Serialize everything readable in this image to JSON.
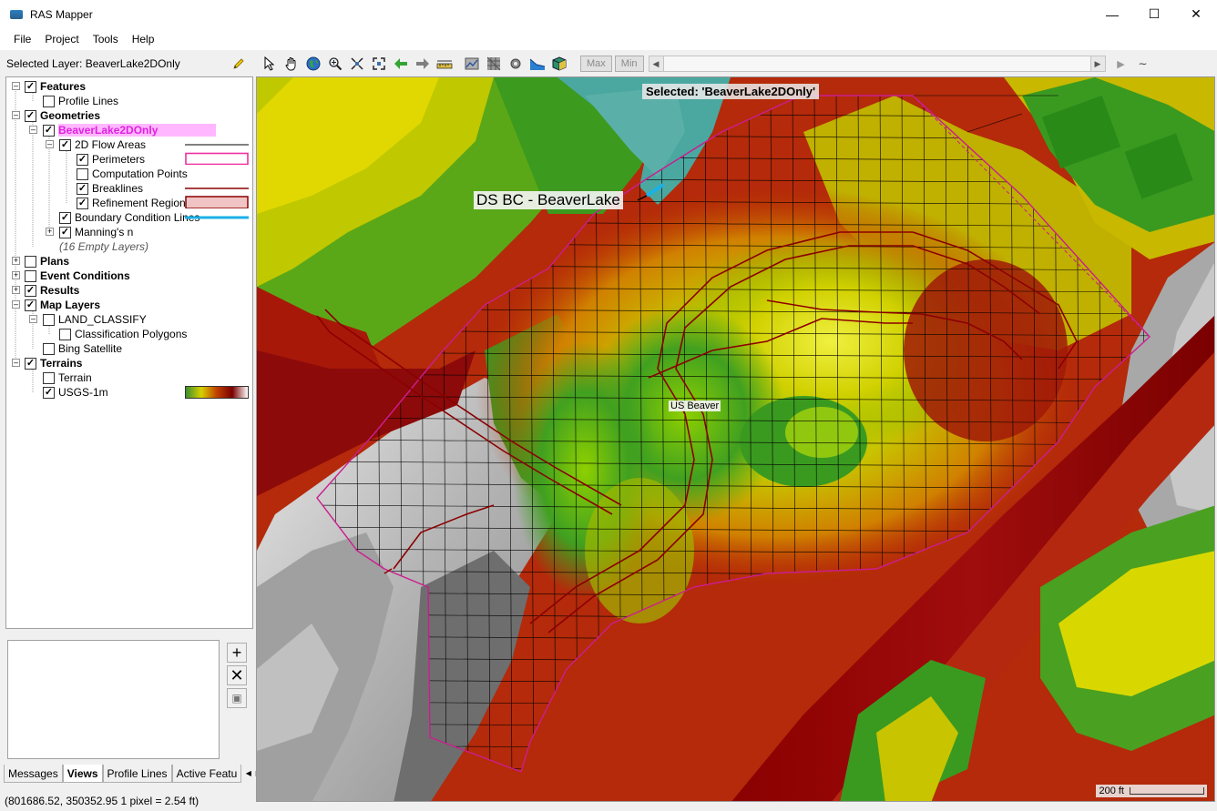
{
  "window": {
    "title": "RAS Mapper"
  },
  "menu": [
    "File",
    "Project",
    "Tools",
    "Help"
  ],
  "selected_layer_text": "Selected Layer: BeaverLake2DOnly",
  "toolbar": {
    "max_label": "Max",
    "min_label": "Min"
  },
  "tree": {
    "features": "Features",
    "profile_lines": "Profile Lines",
    "geometries": "Geometries",
    "beaverlake": "BeaverLake2DOnly",
    "flow_areas": "2D Flow Areas",
    "perimeters": "Perimeters",
    "computation_points": "Computation Points",
    "breaklines": "Breaklines",
    "refinement_regions": "Refinement Regions",
    "boundary_condition_lines": "Boundary Condition Lines",
    "mannings_n": "Manning's n",
    "empty_layers": "(16 Empty Layers)",
    "plans": "Plans",
    "event_conditions": "Event Conditions",
    "results": "Results",
    "map_layers": "Map Layers",
    "land_classify": "LAND_CLASSIFY",
    "classification_polygons": "Classification Polygons",
    "bing_satellite": "Bing Satellite",
    "terrains": "Terrains",
    "terrain": "Terrain",
    "usgs": "USGS-1m"
  },
  "tabs": [
    "Messages",
    "Views",
    "Profile Lines",
    "Active Featu"
  ],
  "status": "(801686.52, 350352.95  1 pixel = 2.54 ft)",
  "map": {
    "selected_label": "Selected: 'BeaverLake2DOnly'",
    "ds_label": "DS BC - BeaverLake",
    "us_label": "US Beaver",
    "scale_label": "200 ft"
  },
  "colors": {
    "perimeter": "#cc1d8f",
    "breakline": "#8b0000",
    "bc_line": "#1ab0e8",
    "highlight": "#ffb8ff"
  }
}
